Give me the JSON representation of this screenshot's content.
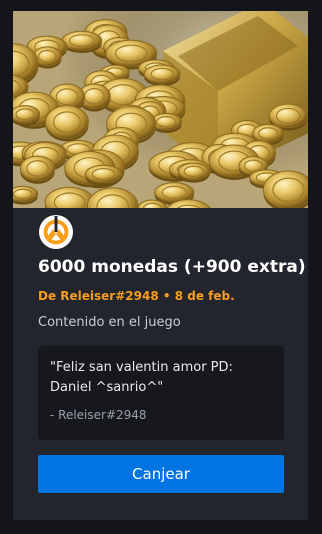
{
  "product": {
    "title": "6000 monedas (+900 extra)",
    "image_subject": "coins-treasure-image",
    "game_icon": "overwatch-logo-icon",
    "accent_color": "#f99e1a"
  },
  "gift": {
    "meta": "De Releiser#2948 • 8 de feb.",
    "content_type": "Contenido en el juego",
    "message": "\"Feliz san valentin amor PD: Daniel ^sanrio^\"",
    "author": "- Releiser#2948"
  },
  "actions": {
    "redeem_label": "Canjear",
    "redeem_color": "#0074e0"
  }
}
